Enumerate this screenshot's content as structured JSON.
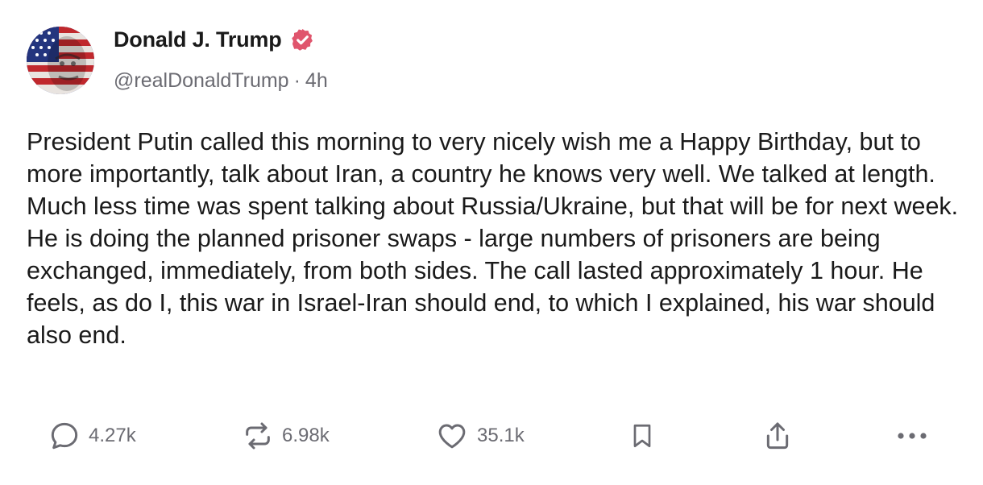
{
  "author": {
    "display_name": "Donald J. Trump",
    "handle": "@realDonaldTrump",
    "separator": "·",
    "time": "4h",
    "verified_icon": "verified-badge-icon",
    "verified_color": "#e0556d"
  },
  "post": {
    "text": "President Putin called this morning to very nicely wish me a Happy Birthday, but to more importantly, talk about Iran, a country he knows very well. We talked at length. Much less time was spent talking about Russia/Ukraine, but that will be for next week. He is doing the planned prisoner swaps - large numbers of prisoners are being exchanged, immediately, from both sides. The call lasted approximately 1 hour. He feels, as do I, this war in Israel-Iran should end, to which I explained, his war should also end."
  },
  "actions": {
    "reply": {
      "icon": "comment-icon",
      "count": "4.27k"
    },
    "repost": {
      "icon": "repost-icon",
      "count": "6.98k"
    },
    "like": {
      "icon": "heart-icon",
      "count": "35.1k"
    },
    "bookmark": {
      "icon": "bookmark-icon"
    },
    "share": {
      "icon": "share-icon"
    },
    "more": {
      "icon": "more-icon"
    }
  },
  "colors": {
    "text": "#1a1a1a",
    "muted": "#6b6b72",
    "background": "#ffffff"
  }
}
